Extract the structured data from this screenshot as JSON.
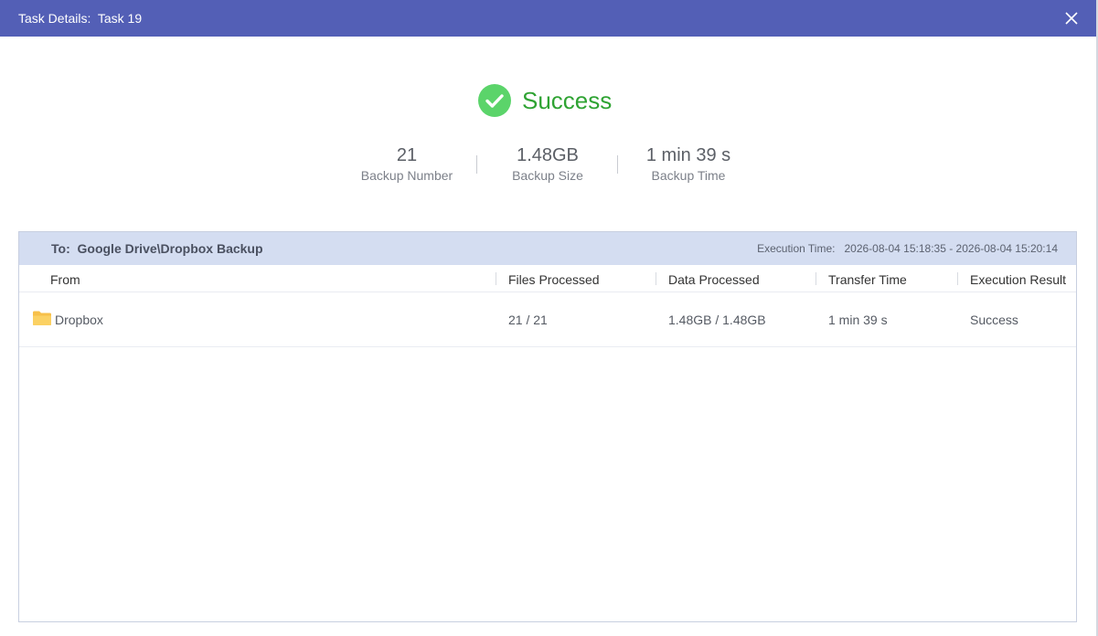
{
  "titlebar": {
    "title": "Task Details:  Task 19"
  },
  "status": {
    "text": "Success",
    "icon": "check-circle-icon",
    "color": "#2fa333"
  },
  "stats": [
    {
      "value": "21",
      "label": "Backup Number"
    },
    {
      "value": "1.48GB",
      "label": "Backup Size"
    },
    {
      "value": "1 min 39 s",
      "label": "Backup Time"
    }
  ],
  "panel": {
    "destination": "To:  Google Drive\\Dropbox Backup",
    "execution_time": "Execution Time:   2026-08-04 15:18:35 - 2026-08-04 15:20:14",
    "columns": [
      "From",
      "Files Processed",
      "Data Processed",
      "Transfer Time",
      "Execution Result"
    ],
    "rows": [
      {
        "from": "Dropbox",
        "icon": "folder-icon",
        "files_processed": "21 / 21",
        "data_processed": "1.48GB / 1.48GB",
        "transfer_time": "1 min 39 s",
        "execution_result": "Success"
      }
    ]
  },
  "colors": {
    "titlebar": "#535fb6",
    "panel_header": "#d4ddf1",
    "success_icon": "#5bd46a"
  }
}
